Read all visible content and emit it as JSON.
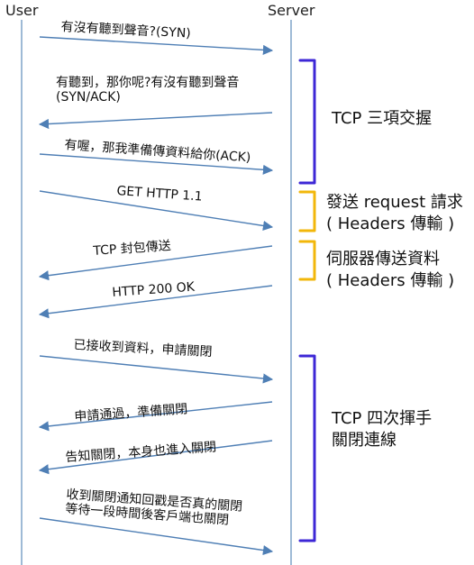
{
  "participants": {
    "user": "User",
    "server": "Server"
  },
  "messages": [
    {
      "text": "有沒有聽到聲音?(SYN)",
      "direction": "to_server"
    },
    {
      "text": "有聽到，那你呢?有沒有聽到聲音\n(SYN/ACK)",
      "direction": "to_user"
    },
    {
      "text": "有喔，那我準備傳資料給你(ACK)",
      "direction": "to_server"
    },
    {
      "text": "GET HTTP 1.1",
      "direction": "to_server"
    },
    {
      "text": "TCP 封包傳送",
      "direction": "to_user"
    },
    {
      "text": "HTTP 200 OK",
      "direction": "to_user"
    },
    {
      "text": "已接收到資料，申請關閉",
      "direction": "to_server"
    },
    {
      "text": "申請通過，準備關閉",
      "direction": "to_user"
    },
    {
      "text": "告知關閉，本身也進入關閉",
      "direction": "to_user"
    },
    {
      "text": "收到關閉通知回戳是否真的關閉\n等待一段時間後客戶端也關閉",
      "direction": "to_server"
    }
  ],
  "phases": [
    {
      "label": "TCP 三項交握",
      "color": "#3d27d6"
    },
    {
      "label": "發送 request 請求\n( Headers 傳輸 )",
      "color": "#f2b70a"
    },
    {
      "label": "伺服器傳送資料\n( Headers 傳輸 )",
      "color": "#f2b70a"
    },
    {
      "label": "TCP 四次揮手\n關閉連線",
      "color": "#3d27d6"
    }
  ],
  "colors": {
    "lifeline": "#7fa3c9",
    "arrow": "#4f7fb5"
  }
}
